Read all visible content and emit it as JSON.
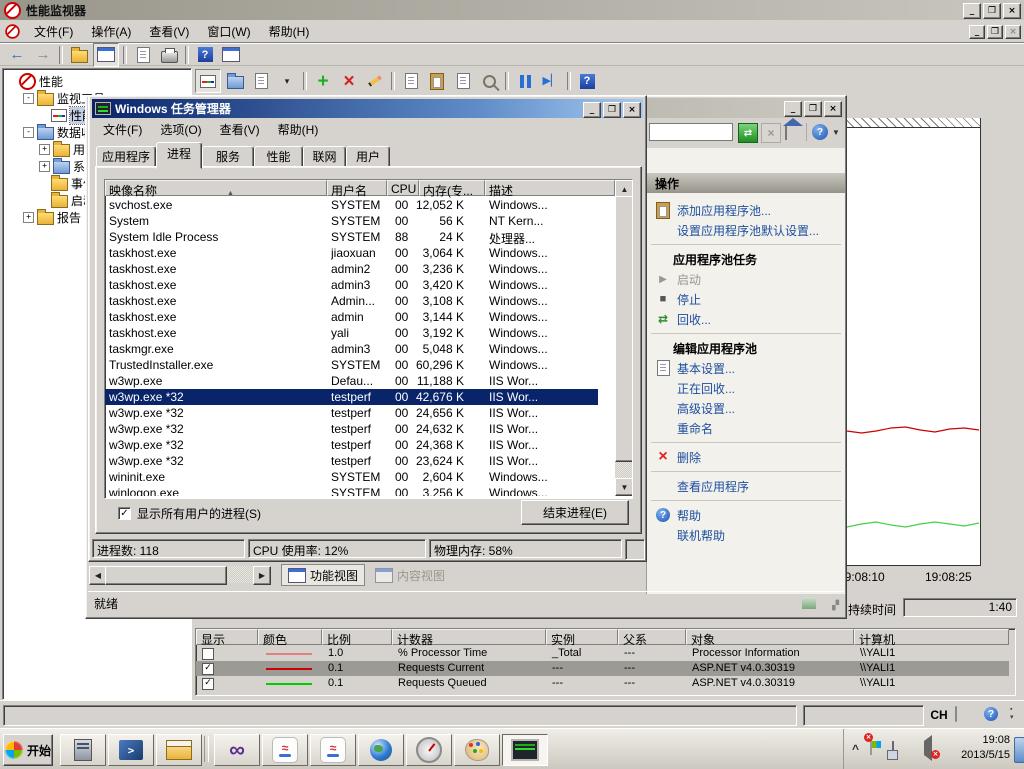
{
  "perfmon": {
    "title": "性能监视器",
    "menu": [
      "文件(F)",
      "操作(A)",
      "查看(V)",
      "窗口(W)",
      "帮助(H)"
    ],
    "toolbar_main": [
      {
        "name": "back-icon"
      },
      {
        "name": "forward-icon"
      },
      {
        "sep": true
      },
      {
        "name": "export-folder-icon"
      },
      {
        "name": "console-tree-icon",
        "pressed": true
      },
      {
        "sep": true
      },
      {
        "name": "properties-icon"
      },
      {
        "name": "export-list-icon"
      },
      {
        "sep": true
      },
      {
        "name": "help-icon"
      },
      {
        "name": "new-window-icon"
      }
    ],
    "toolbar_chart": [
      {
        "name": "chart-type-icon",
        "pressed": true
      },
      {
        "name": "counter-folder-icon"
      },
      {
        "name": "histogram-icon"
      },
      {
        "name": "dropdown-icon"
      },
      {
        "sep": true
      },
      {
        "name": "add-counter-icon"
      },
      {
        "name": "delete-counter-icon"
      },
      {
        "name": "highlight-icon"
      },
      {
        "sep": true
      },
      {
        "name": "copy-properties-icon"
      },
      {
        "name": "paste-counter-icon"
      },
      {
        "name": "properties-icon"
      },
      {
        "name": "zoom-icon"
      },
      {
        "sep": true
      },
      {
        "name": "freeze-display-icon"
      },
      {
        "name": "update-data-icon"
      },
      {
        "sep": true
      },
      {
        "name": "help-icon"
      }
    ],
    "tree": [
      {
        "label": "性能",
        "level": 0,
        "expander": "",
        "icon": "perfmon-icon",
        "selected": false
      },
      {
        "label": "监视工具",
        "level": 1,
        "expander": "-",
        "icon": "folder-icon",
        "selected": false
      },
      {
        "label": "性能监视器",
        "level": 2,
        "expander": "",
        "icon": "chart-icon",
        "selected": true
      },
      {
        "label": "数据收集器集",
        "level": 1,
        "expander": "-",
        "icon": "folder-blue-icon",
        "selected": false
      },
      {
        "label": "用户定义",
        "level": 2,
        "expander": "+",
        "icon": "folder-user-icon",
        "selected": false
      },
      {
        "label": "系统",
        "level": 2,
        "expander": "+",
        "icon": "folder-blue-icon",
        "selected": false
      },
      {
        "label": "事件跟踪会话",
        "level": 2,
        "expander": "",
        "icon": "folder-icon",
        "selected": false
      },
      {
        "label": "启动事件跟踪会话",
        "level": 2,
        "expander": "",
        "icon": "folder-icon",
        "selected": false
      },
      {
        "label": "报告",
        "level": 1,
        "expander": "+",
        "icon": "folder-report-icon",
        "selected": false
      }
    ],
    "chart": {
      "type": "line",
      "x_labels": [
        "19:08:10",
        "19:08:25"
      ],
      "duration_label": "持续时间",
      "duration_value": "1:40",
      "series": [
        {
          "name": "Requests Current",
          "color": "#cc0000",
          "trace_y": [
            430,
            428,
            431,
            427,
            429,
            432,
            430,
            427,
            425,
            428,
            431,
            433,
            431,
            428,
            427,
            430,
            432,
            429,
            428,
            430
          ]
        },
        {
          "name": "Requests Queued",
          "color": "#46d046",
          "trace_y": [
            523,
            521,
            519,
            516,
            513,
            516,
            518,
            520,
            523,
            525,
            527,
            524,
            522,
            525,
            527,
            524,
            522,
            524,
            526,
            523
          ]
        }
      ],
      "legend": {
        "headers": [
          "显示",
          "颜色",
          "比例",
          "计数器",
          "实例",
          "父系",
          "对象",
          "计算机"
        ],
        "rows": [
          {
            "show": false,
            "color": "#e08080",
            "scale": "1.0",
            "counter": "% Processor Time",
            "instance": "_Total",
            "parent": "---",
            "object": "Processor Information",
            "computer": "\\\\YALI1",
            "highlight": false
          },
          {
            "show": true,
            "color": "#cc0000",
            "scale": "0.1",
            "counter": "Requests Current",
            "instance": "---",
            "parent": "---",
            "object": "ASP.NET v4.0.30319",
            "computer": "\\\\YALI1",
            "highlight": true
          },
          {
            "show": true,
            "color": "#00cc00",
            "scale": "0.1",
            "counter": "Requests Queued",
            "instance": "---",
            "parent": "---",
            "object": "ASP.NET v4.0.30319",
            "computer": "\\\\YALI1",
            "highlight": false
          }
        ]
      }
    },
    "language_bar": {
      "indicator": "CH"
    }
  },
  "taskmgr": {
    "title": "Windows 任务管理器",
    "menu": [
      "文件(F)",
      "选项(O)",
      "查看(V)",
      "帮助(H)"
    ],
    "tabs": [
      {
        "label": "应用程序",
        "active": false
      },
      {
        "label": "进程",
        "active": true
      },
      {
        "label": "服务",
        "active": false
      },
      {
        "label": "性能",
        "active": false
      },
      {
        "label": "联网",
        "active": false
      },
      {
        "label": "用户",
        "active": false
      }
    ],
    "columns": [
      "映像名称",
      "用户名",
      "CPU",
      "内存(专...",
      "描述"
    ],
    "selected_row": 12,
    "rows": [
      [
        "svchost.exe",
        "SYSTEM",
        "00",
        "12,052 K",
        "Windows..."
      ],
      [
        "System",
        "SYSTEM",
        "00",
        "56 K",
        "NT Kern..."
      ],
      [
        "System Idle Process",
        "SYSTEM",
        "88",
        "24 K",
        "处理器..."
      ],
      [
        "taskhost.exe",
        "jiaoxuan",
        "00",
        "3,064 K",
        "Windows..."
      ],
      [
        "taskhost.exe",
        "admin2",
        "00",
        "3,236 K",
        "Windows..."
      ],
      [
        "taskhost.exe",
        "admin3",
        "00",
        "3,420 K",
        "Windows..."
      ],
      [
        "taskhost.exe",
        "Admin...",
        "00",
        "3,108 K",
        "Windows..."
      ],
      [
        "taskhost.exe",
        "admin",
        "00",
        "3,144 K",
        "Windows..."
      ],
      [
        "taskhost.exe",
        "yali",
        "00",
        "3,192 K",
        "Windows..."
      ],
      [
        "taskmgr.exe",
        "admin3",
        "00",
        "5,048 K",
        "Windows..."
      ],
      [
        "TrustedInstaller.exe",
        "SYSTEM",
        "00",
        "60,296 K",
        "Windows..."
      ],
      [
        "w3wp.exe",
        "Defau...",
        "00",
        "11,188 K",
        "IIS Wor..."
      ],
      [
        "w3wp.exe *32",
        "testperf",
        "00",
        "42,676 K",
        "IIS Wor..."
      ],
      [
        "w3wp.exe *32",
        "testperf",
        "00",
        "24,656 K",
        "IIS Wor..."
      ],
      [
        "w3wp.exe *32",
        "testperf",
        "00",
        "24,632 K",
        "IIS Wor..."
      ],
      [
        "w3wp.exe *32",
        "testperf",
        "00",
        "24,368 K",
        "IIS Wor..."
      ],
      [
        "w3wp.exe *32",
        "testperf",
        "00",
        "23,624 K",
        "IIS Wor..."
      ],
      [
        "wininit.exe",
        "SYSTEM",
        "00",
        "2,604 K",
        "Windows..."
      ],
      [
        "winlogon.exe",
        "SYSTEM",
        "00",
        "3,256 K",
        "Windows..."
      ]
    ],
    "show_all_label": "显示所有用户的进程(S)",
    "end_process_label": "结束进程(E)",
    "status": [
      "进程数: 118",
      "CPU 使用率: 12%",
      "物理内存: 58%"
    ]
  },
  "iis": {
    "actions_title": "操作",
    "actions": [
      {
        "type": "link",
        "icon": "add-app-pool-icon",
        "label": "添加应用程序池..."
      },
      {
        "type": "link",
        "icon": "",
        "label": "设置应用程序池默认设置..."
      },
      {
        "type": "sep"
      },
      {
        "type": "header",
        "label": "应用程序池任务"
      },
      {
        "type": "link",
        "icon": "play-icon",
        "label": "启动",
        "disabled": true
      },
      {
        "type": "link",
        "icon": "stop-icon",
        "label": "停止"
      },
      {
        "type": "link",
        "icon": "recycle-icon",
        "label": "回收..."
      },
      {
        "type": "sep"
      },
      {
        "type": "header",
        "label": "编辑应用程序池"
      },
      {
        "type": "link",
        "icon": "basic-settings-icon",
        "label": "基本设置..."
      },
      {
        "type": "link",
        "icon": "",
        "label": "正在回收..."
      },
      {
        "type": "link",
        "icon": "",
        "label": "高级设置..."
      },
      {
        "type": "link",
        "icon": "",
        "label": "重命名"
      },
      {
        "type": "sep"
      },
      {
        "type": "link",
        "icon": "delete-x-icon",
        "label": "删除"
      },
      {
        "type": "sep"
      },
      {
        "type": "link",
        "icon": "",
        "label": "查看应用程序"
      },
      {
        "type": "sep"
      },
      {
        "type": "link",
        "icon": "help-round-icon",
        "label": "帮助"
      },
      {
        "type": "link",
        "icon": "",
        "label": "联机帮助"
      }
    ],
    "view_tabs": [
      {
        "label": "功能视图",
        "active": true
      },
      {
        "label": "内容视图",
        "active": false
      }
    ],
    "status": "就绪"
  },
  "taskbar": {
    "start": "开始",
    "buttons": [
      {
        "name": "server-manager-button",
        "icon": "server-icon"
      },
      {
        "name": "powershell-button",
        "icon": "powershell-icon"
      },
      {
        "name": "iis-manager-button",
        "icon": "iis-icon"
      },
      {
        "sep": true
      },
      {
        "name": "visual-studio-button",
        "icon": "visual-studio-icon"
      },
      {
        "name": "java-app-button-1",
        "icon": "java-icon"
      },
      {
        "name": "java-app-button-2",
        "icon": "java-icon"
      },
      {
        "name": "network-app-button",
        "icon": "globe-icon"
      },
      {
        "name": "gauge-app-button",
        "icon": "gauge-icon"
      },
      {
        "name": "paint-app-button",
        "icon": "paint-icon"
      },
      {
        "name": "performance-monitor-taskbar-button",
        "icon": "monitor-icon",
        "active": true
      }
    ],
    "tray": {
      "time": "19:08",
      "date": "2013/5/15"
    }
  }
}
